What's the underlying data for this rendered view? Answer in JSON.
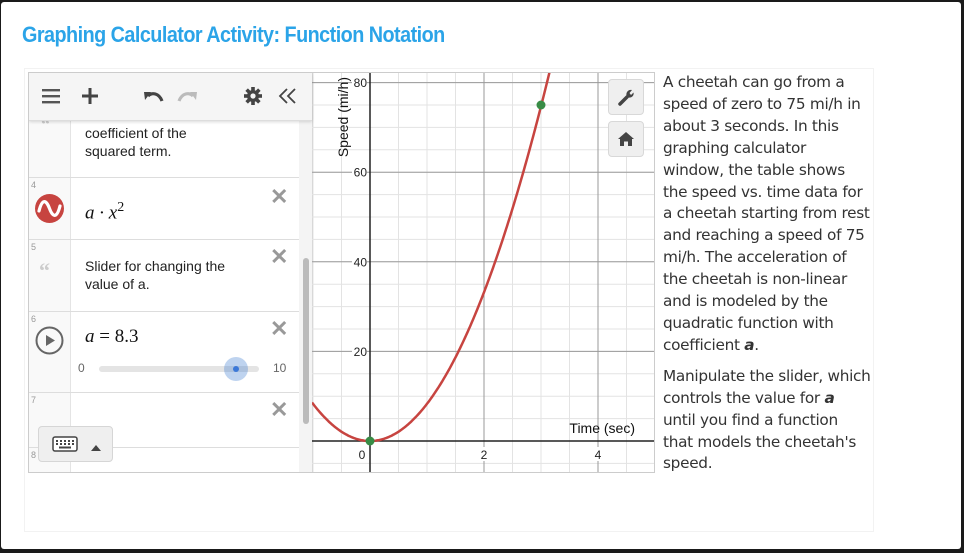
{
  "page": {
    "title": "Graphing Calculator Activity: Function Notation"
  },
  "toolbar": {
    "menu_icon": "hamburger-menu-icon",
    "add_icon": "plus-icon",
    "undo_icon": "undo-icon",
    "redo_icon": "redo-icon",
    "settings_icon": "gear-icon",
    "collapse_icon": "double-chevron-left-icon"
  },
  "expressions": [
    {
      "number": "",
      "type": "note",
      "text_line1": "coefficient of the",
      "text_line2": "squared term."
    },
    {
      "number": "4",
      "type": "expression",
      "latex_base": "a · x",
      "latex_exp": "2",
      "color": "#c74440"
    },
    {
      "number": "5",
      "type": "note",
      "text_line1": "Slider for changing the",
      "text_line2": "value of a."
    },
    {
      "number": "6",
      "type": "slider",
      "variable": "a",
      "equals": "=",
      "value_text": "8.3",
      "value": 8.3,
      "min": 0,
      "max": 10,
      "min_label": "0",
      "max_label": "10"
    },
    {
      "number": "7",
      "type": "empty"
    },
    {
      "number": "8",
      "type": "empty"
    }
  ],
  "keyboard": {
    "icon": "keyboard-icon",
    "toggle_icon": "caret-up-icon"
  },
  "graph_buttons": {
    "wrench": "wrench-icon",
    "home": "home-icon"
  },
  "chart_data": {
    "type": "line",
    "title": "",
    "xlabel": "Time (sec)",
    "ylabel": "Speed (mi/h)",
    "xlim": [
      -1.0,
      5.0
    ],
    "ylim": [
      -6,
      82
    ],
    "x_ticks": [
      0,
      2,
      4
    ],
    "x_tick_labels": [
      "0",
      "2",
      "4"
    ],
    "y_ticks": [
      20,
      40,
      60,
      80
    ],
    "y_tick_labels": [
      "20",
      "40",
      "60",
      "80"
    ],
    "grid": true,
    "series": [
      {
        "name": "a · x^2",
        "function": "a*x^2",
        "a": 8.3,
        "color": "#c74440"
      }
    ],
    "points": [
      {
        "x": 0,
        "y": 0,
        "color": "#388c46"
      },
      {
        "x": 3,
        "y": 75,
        "color": "#388c46"
      }
    ]
  },
  "description": {
    "para1_before": "A cheetah can go from a speed of zero to 75 mi/h in about 3 seconds. In this graphing calculator window, the table shows the speed vs. time data for a cheetah starting from rest and reaching a speed of 75 mi/h. The acceleration of the cheetah is non-linear and is modeled by the quadratic function with coefficient ",
    "para1_var": "a",
    "para1_after": ".",
    "para2_before": "Manipulate the slider, which controls the value for ",
    "para2_var": "a",
    "para2_after": " until you find a function that models the cheetah's speed."
  }
}
